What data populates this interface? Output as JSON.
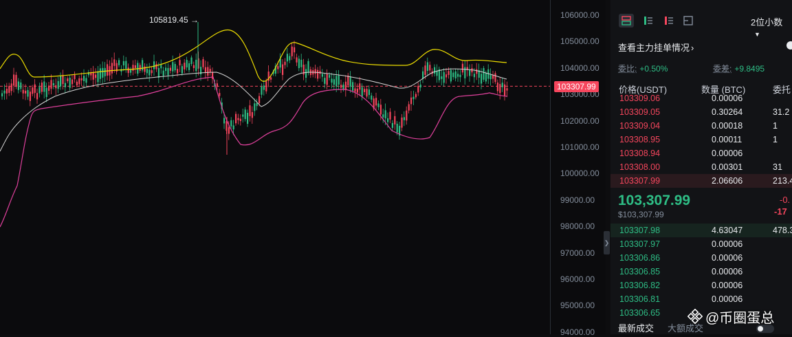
{
  "chart": {
    "max_label": "105819.45 →",
    "current_price_tag": "103307.99",
    "price_ticks": [
      "106000.00",
      "105000.00",
      "104000.00",
      "103000.00",
      "102000.00",
      "101000.00",
      "100000.00",
      "99000.00",
      "98000.00",
      "97000.00",
      "96000.00",
      "95000.00",
      "94000.00"
    ],
    "colors": {
      "up": "#2ebd85",
      "down": "#f6465d",
      "upper_band": "#f0e000",
      "lower_band": "#e0409c",
      "mid_band": "#d8d8d8",
      "current_line": "#f6465d"
    }
  },
  "orderbook": {
    "decimals": "2位小数",
    "main_orders_label": "查看主力挂单情况",
    "ratio": {
      "label": "委比:",
      "value": "+0.50%"
    },
    "diff": {
      "label": "委差:",
      "value": "+9.8495"
    },
    "headers": {
      "price": "价格(USDT)",
      "qty": "数量 (BTC)",
      "total": "委托"
    },
    "asks": [
      {
        "price": "103309.06",
        "qty": "0.00006",
        "total": ""
      },
      {
        "price": "103309.05",
        "qty": "0.30264",
        "total": "31.2"
      },
      {
        "price": "103309.04",
        "qty": "0.00018",
        "total": "1"
      },
      {
        "price": "103308.95",
        "qty": "0.00011",
        "total": "1"
      },
      {
        "price": "103308.94",
        "qty": "0.00006",
        "total": ""
      },
      {
        "price": "103308.00",
        "qty": "0.00301",
        "total": "31"
      },
      {
        "price": "103307.99",
        "qty": "2.06606",
        "total": "213.4"
      }
    ],
    "last_price": "103,307.99",
    "last_price_usd": "$103,307.99",
    "change1": "-0.",
    "change2": "-17",
    "bids": [
      {
        "price": "103307.98",
        "qty": "4.63047",
        "total": "478.3"
      },
      {
        "price": "103307.97",
        "qty": "0.00006",
        "total": ""
      },
      {
        "price": "103306.86",
        "qty": "0.00006",
        "total": ""
      },
      {
        "price": "103306.85",
        "qty": "0.00006",
        "total": ""
      },
      {
        "price": "103306.82",
        "qty": "0.00006",
        "total": ""
      },
      {
        "price": "103306.81",
        "qty": "0.00006",
        "total": ""
      },
      {
        "price": "103306.65",
        "qty": "",
        "total": ""
      }
    ],
    "tabs": {
      "latest": "最新成交",
      "large": "大额成交"
    }
  },
  "watermark": "@币圈蛋总"
}
